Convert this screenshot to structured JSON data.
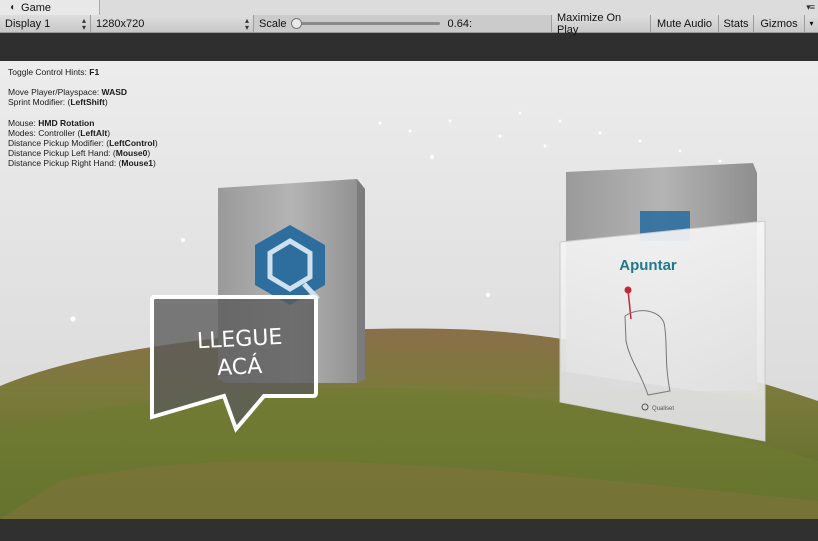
{
  "tab": {
    "icon": "unity-icon",
    "label": "Game",
    "menu_icon": "tab-menu-icon"
  },
  "toolbar": {
    "display": "Display 1",
    "resolution": "1280x720",
    "scale_label": "Scale",
    "scale_value": "0.64:",
    "scale_fraction": 0.0,
    "maximize": "Maximize On Play",
    "mute": "Mute Audio",
    "stats": "Stats",
    "gizmos": "Gizmos"
  },
  "hud": {
    "toggle_prefix": "Toggle Control Hints: ",
    "toggle_key": "F1",
    "move_prefix": "Move Player/Playspace: ",
    "move_key": "WASD",
    "sprint_prefix": "Sprint Modifier: (",
    "sprint_key": "LeftShift",
    "mouse_prefix": "Mouse: ",
    "mouse_key": "HMD Rotation",
    "modes_prefix": "Modes: Controller (",
    "modes_key": "LeftAlt",
    "dpm_prefix": "Distance Pickup Modifier: (",
    "dpm_key": "LeftControl",
    "dpl_prefix": "Distance Pickup Left Hand: (",
    "dpl_key": "Mouse0",
    "dpr_prefix": "Distance Pickup Right Hand: (",
    "dpr_key": "Mouse1",
    "close": ")"
  },
  "scene": {
    "bubble_line1": "LLEGUE",
    "bubble_line2": "ACÁ",
    "panel_title": "Apuntar",
    "panel_footer": "Qualiset"
  },
  "colors": {
    "accent_blue": "#2d6e9e",
    "panel_title": "#1f7a8c"
  }
}
